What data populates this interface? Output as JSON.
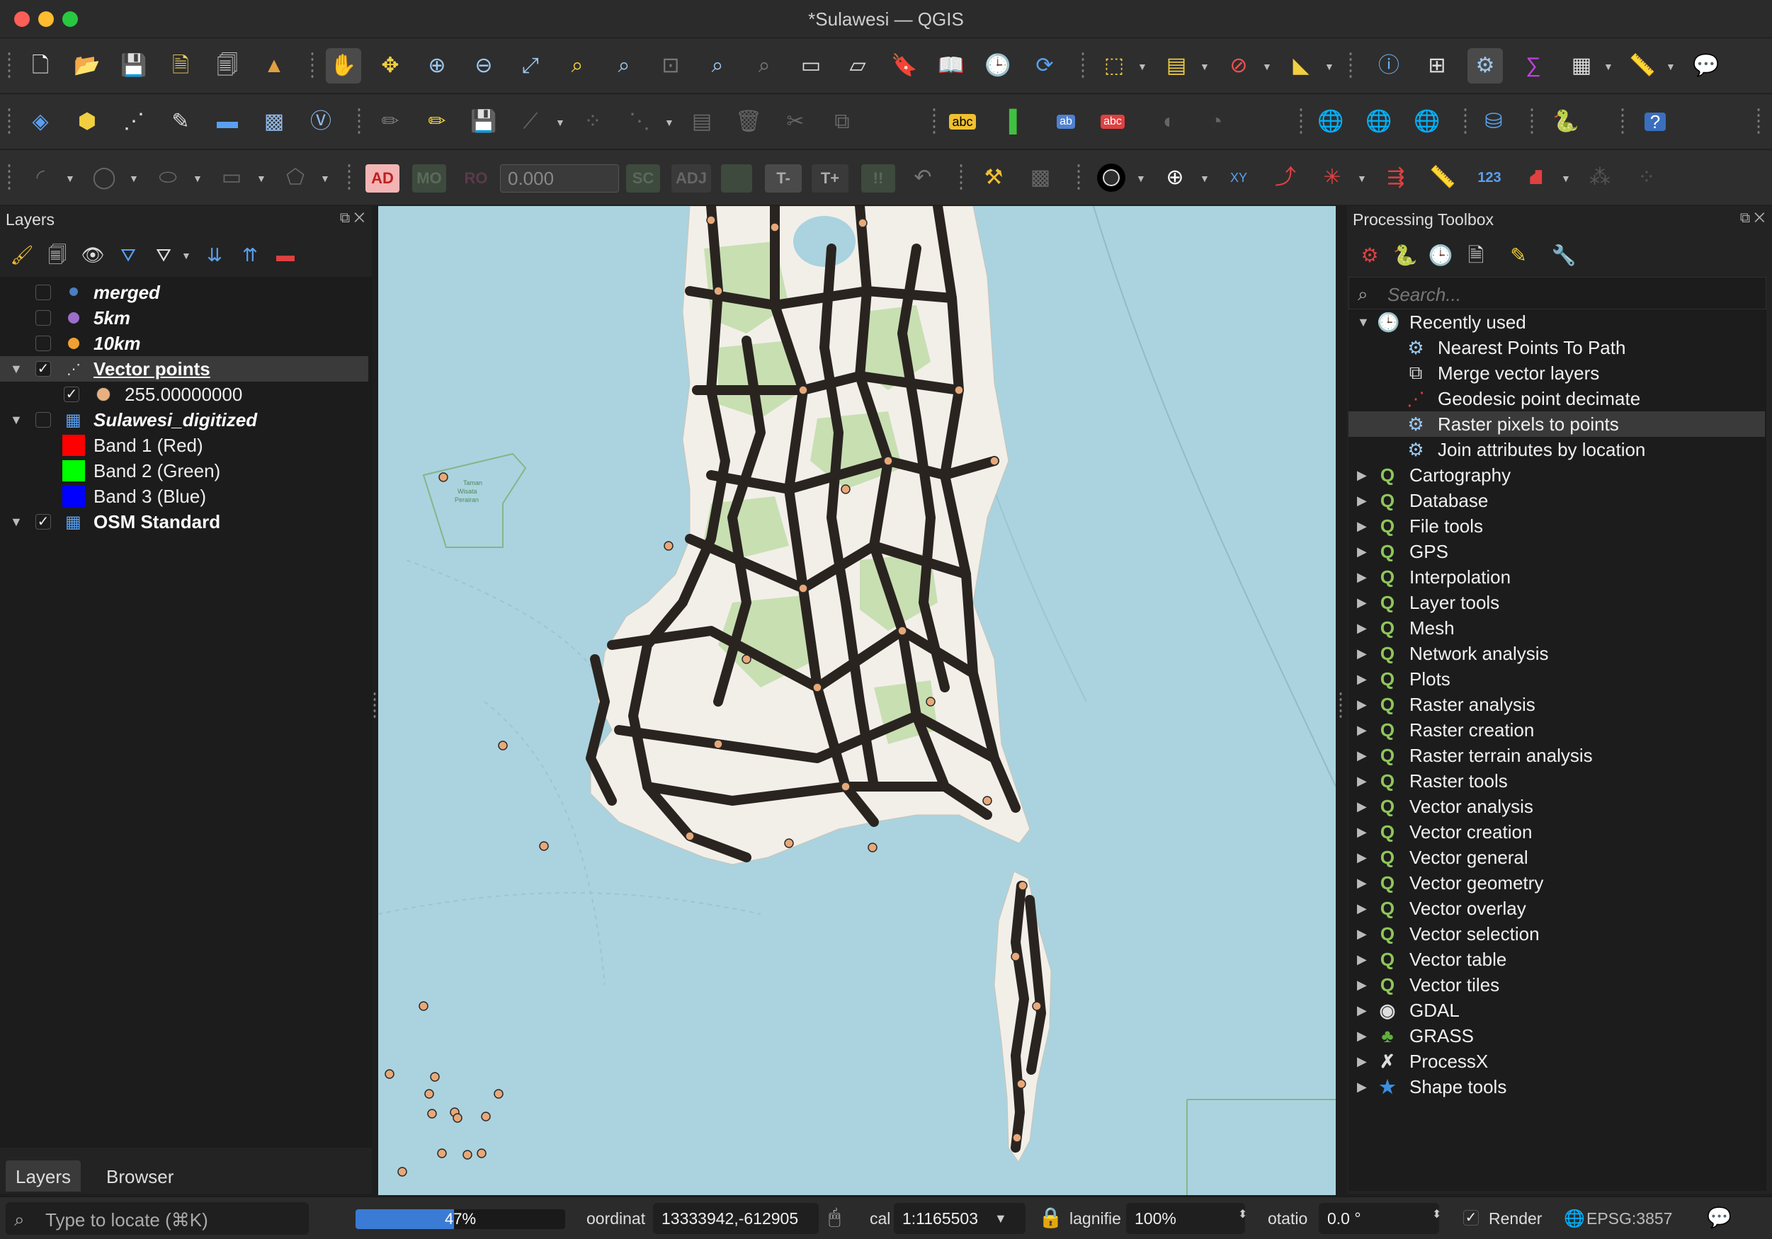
{
  "window": {
    "title": "*Sulawesi — QGIS"
  },
  "layers_panel": {
    "title": "Layers",
    "layers": [
      {
        "label": "merged",
        "checked": false,
        "style": "italic",
        "symbol_color": "#4a7fc1"
      },
      {
        "label": "5km",
        "checked": false,
        "style": "italic",
        "symbol_color": "#9b6fc9"
      },
      {
        "label": "10km",
        "checked": false,
        "style": "italic",
        "symbol_color": "#f0a030"
      },
      {
        "label": "Vector points",
        "checked": true,
        "style": "bold-underline",
        "expanded": true,
        "selected": true
      },
      {
        "label": "255.00000000",
        "checked": true,
        "style": "legend",
        "symbol_color": "#e8b080"
      },
      {
        "label": "Sulawesi_digitized",
        "checked": false,
        "style": "italic",
        "expanded": true
      },
      {
        "label": "Band 1 (Red)",
        "style": "band",
        "symbol_color": "#ff0000"
      },
      {
        "label": "Band 2 (Green)",
        "style": "band",
        "symbol_color": "#00ff00"
      },
      {
        "label": "Band 3 (Blue)",
        "style": "band",
        "symbol_color": "#0000ff"
      },
      {
        "label": "OSM Standard",
        "checked": true,
        "style": "bold",
        "expanded": true
      }
    ],
    "tabs": [
      "Layers",
      "Browser"
    ]
  },
  "toolbox": {
    "title": "Processing Toolbox",
    "search_placeholder": "Search...",
    "recently_used": {
      "label": "Recently used",
      "items": [
        {
          "label": "Nearest Points To Path",
          "icon": "gear-icon"
        },
        {
          "label": "Merge vector layers",
          "icon": "merge-icon"
        },
        {
          "label": "Geodesic point decimate",
          "icon": "decimate-icon"
        },
        {
          "label": "Raster pixels to points",
          "icon": "gear-icon",
          "selected": true
        },
        {
          "label": "Join attributes by location",
          "icon": "gear-icon"
        }
      ]
    },
    "groups": [
      {
        "label": "Cartography",
        "icon": "qgis-icon"
      },
      {
        "label": "Database",
        "icon": "qgis-icon"
      },
      {
        "label": "File tools",
        "icon": "qgis-icon"
      },
      {
        "label": "GPS",
        "icon": "qgis-icon"
      },
      {
        "label": "Interpolation",
        "icon": "qgis-icon"
      },
      {
        "label": "Layer tools",
        "icon": "qgis-icon"
      },
      {
        "label": "Mesh",
        "icon": "qgis-icon"
      },
      {
        "label": "Network analysis",
        "icon": "qgis-icon"
      },
      {
        "label": "Plots",
        "icon": "qgis-icon"
      },
      {
        "label": "Raster analysis",
        "icon": "qgis-icon"
      },
      {
        "label": "Raster creation",
        "icon": "qgis-icon"
      },
      {
        "label": "Raster terrain analysis",
        "icon": "qgis-icon"
      },
      {
        "label": "Raster tools",
        "icon": "qgis-icon"
      },
      {
        "label": "Vector analysis",
        "icon": "qgis-icon"
      },
      {
        "label": "Vector creation",
        "icon": "qgis-icon"
      },
      {
        "label": "Vector general",
        "icon": "qgis-icon"
      },
      {
        "label": "Vector geometry",
        "icon": "qgis-icon"
      },
      {
        "label": "Vector overlay",
        "icon": "qgis-icon"
      },
      {
        "label": "Vector selection",
        "icon": "qgis-icon"
      },
      {
        "label": "Vector table",
        "icon": "qgis-icon"
      },
      {
        "label": "Vector tiles",
        "icon": "qgis-icon"
      },
      {
        "label": "GDAL",
        "icon": "gdal-icon"
      },
      {
        "label": "GRASS",
        "icon": "grass-icon"
      },
      {
        "label": "ProcessX",
        "icon": "processx-icon"
      },
      {
        "label": "Shape tools",
        "icon": "star-icon"
      }
    ]
  },
  "toolbar": {
    "snapping_tolerance": "0.000",
    "digitizing_labels": [
      "AD",
      "MO",
      "RO",
      "SC",
      "ADJ",
      "T-",
      "T+"
    ],
    "numeric_label": "123",
    "xy_label": "XY"
  },
  "statusbar": {
    "locate_placeholder": "Type to locate (⌘K)",
    "progress_text": "47%",
    "progress_value": 0.47,
    "coordinate_label": "oordinat",
    "coordinate_value": "13333942,-612905",
    "scale_label": "cal",
    "scale_value": "1:1165503",
    "magnifier_label": "lagnifie",
    "magnifier_value": "100%",
    "rotation_label": "otatio",
    "rotation_value": "0.0 °",
    "render_label": "Render",
    "render_checked": true,
    "crs": "EPSG:3857"
  },
  "colors": {
    "sea": "#aad3df",
    "land": "#f2efe9",
    "park": "#add19e",
    "point_fill": "#e8a878",
    "point_stroke": "#2a2a2a",
    "selection": "#3a3a3a",
    "progress": "#3a7bd5"
  }
}
